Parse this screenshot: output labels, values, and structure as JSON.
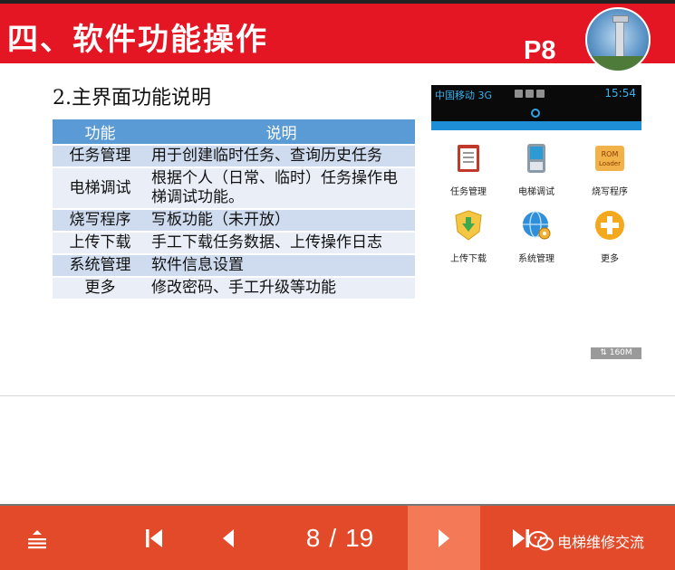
{
  "slide": {
    "title": "四、软件功能操作",
    "page_label": "P8",
    "subtitle": "2.主界面功能说明"
  },
  "table": {
    "headers": [
      "功能",
      "说明"
    ],
    "rows": [
      {
        "func": "任务管理",
        "desc": "用于创建临时任务、查询历史任务"
      },
      {
        "func": "电梯调试",
        "desc": "根据个人（日常、临时）任务操作电梯调试功能。"
      },
      {
        "func": "烧写程序",
        "desc": "写板功能（未开放）"
      },
      {
        "func": "上传下载",
        "desc": "手工下载任务数据、上传操作日志"
      },
      {
        "func": "系统管理",
        "desc": "软件信息设置"
      },
      {
        "func": "更多",
        "desc": "修改密码、手工升级等功能"
      }
    ]
  },
  "phone": {
    "carrier": "中国移动 3G",
    "time": "15:54",
    "memory": "160M",
    "apps": [
      {
        "label": "任务管理",
        "icon": "clipboard-icon"
      },
      {
        "label": "电梯调试",
        "icon": "handheld-device-icon"
      },
      {
        "label": "烧写程序",
        "icon": "rom-loader-icon",
        "icon_text": "ROM Loader"
      },
      {
        "label": "上传下载",
        "icon": "upload-download-icon"
      },
      {
        "label": "系统管理",
        "icon": "globe-gear-icon"
      },
      {
        "label": "更多",
        "icon": "plus-icon"
      }
    ]
  },
  "viewer": {
    "current_page": "8",
    "separator": "/",
    "total_pages": "19",
    "watermark": "电梯维修交流",
    "accent_color": "#e34a2a",
    "header_color": "#e41623"
  }
}
